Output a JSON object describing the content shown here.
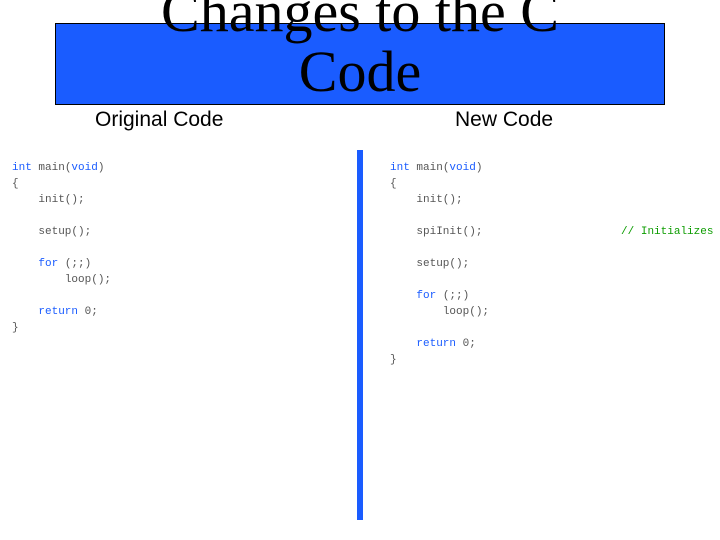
{
  "title": {
    "line1": "Changes to the C",
    "line2": "Code"
  },
  "columns": {
    "left_label": "Original Code",
    "right_label": "New Code"
  },
  "code_tokens": {
    "int": "int",
    "void": "void",
    "for": "for",
    "return": "return",
    "main_sig_open": " main(",
    "main_sig_close": ")",
    "brace_open": "{",
    "brace_close": "}",
    "init_call": "init();",
    "spiInit_call": "spiInit();",
    "setup_call": "setup();",
    "for_head": " (;;)",
    "loop_call": "loop();",
    "return_zero": " 0;",
    "comment_init_spi": "// Initializes spi"
  }
}
